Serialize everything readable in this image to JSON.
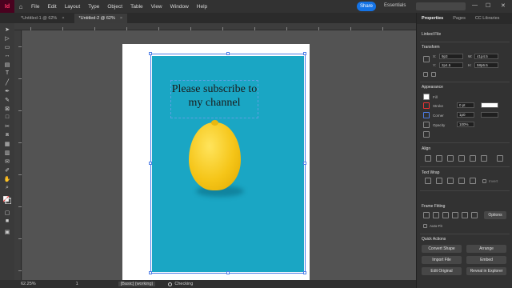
{
  "menubar": {
    "logo": "Id",
    "items": [
      "File",
      "Edit",
      "Layout",
      "Type",
      "Object",
      "Table",
      "View",
      "Window",
      "Help"
    ],
    "share": "Share",
    "workspace": "Essentials",
    "win_min": "—",
    "win_max": "☐",
    "win_close": "✕"
  },
  "tabs": [
    {
      "label": "*Untitled-1 @ 62%",
      "close": "×"
    },
    {
      "label": "*Untitled-2 @ 62%",
      "close": "×"
    }
  ],
  "document": {
    "text": "Please subscribe to my channel"
  },
  "statusbar": {
    "zoom": "62.25%",
    "page": "1",
    "style": "[Basic] (working)",
    "preflight": "Checking"
  },
  "panel": {
    "tabs": [
      "Properties",
      "Pages",
      "CC Libraries"
    ],
    "linked_file": "Linked File",
    "transform": "Transform",
    "x_label": "X:",
    "x_value": "9p3",
    "y_label": "Y:",
    "y_value": "2p4.5",
    "w_label": "W:",
    "w_value": "41p4.5",
    "h_label": "H:",
    "h_value": "58p6.5",
    "appearance": "Appearance",
    "fill": "Fill",
    "stroke": "Stroke",
    "stroke_value": "0 pt",
    "corner": "Corner",
    "corner_value": "1p0",
    "opacity": "Opacity",
    "opacity_value": "100%",
    "align": "Align",
    "text_wrap": "Text Wrap",
    "invert": "Invert",
    "frame_fitting": "Frame Fitting",
    "options": "Options",
    "auto_fit": "Auto-Fit",
    "quick_actions": "Quick Actions",
    "convert_shape": "Convert Shape",
    "arrange": "Arrange",
    "import_file": "Import File",
    "embed": "Embed",
    "edit_original": "Edit Original",
    "reveal": "Reveal in Explorer"
  }
}
